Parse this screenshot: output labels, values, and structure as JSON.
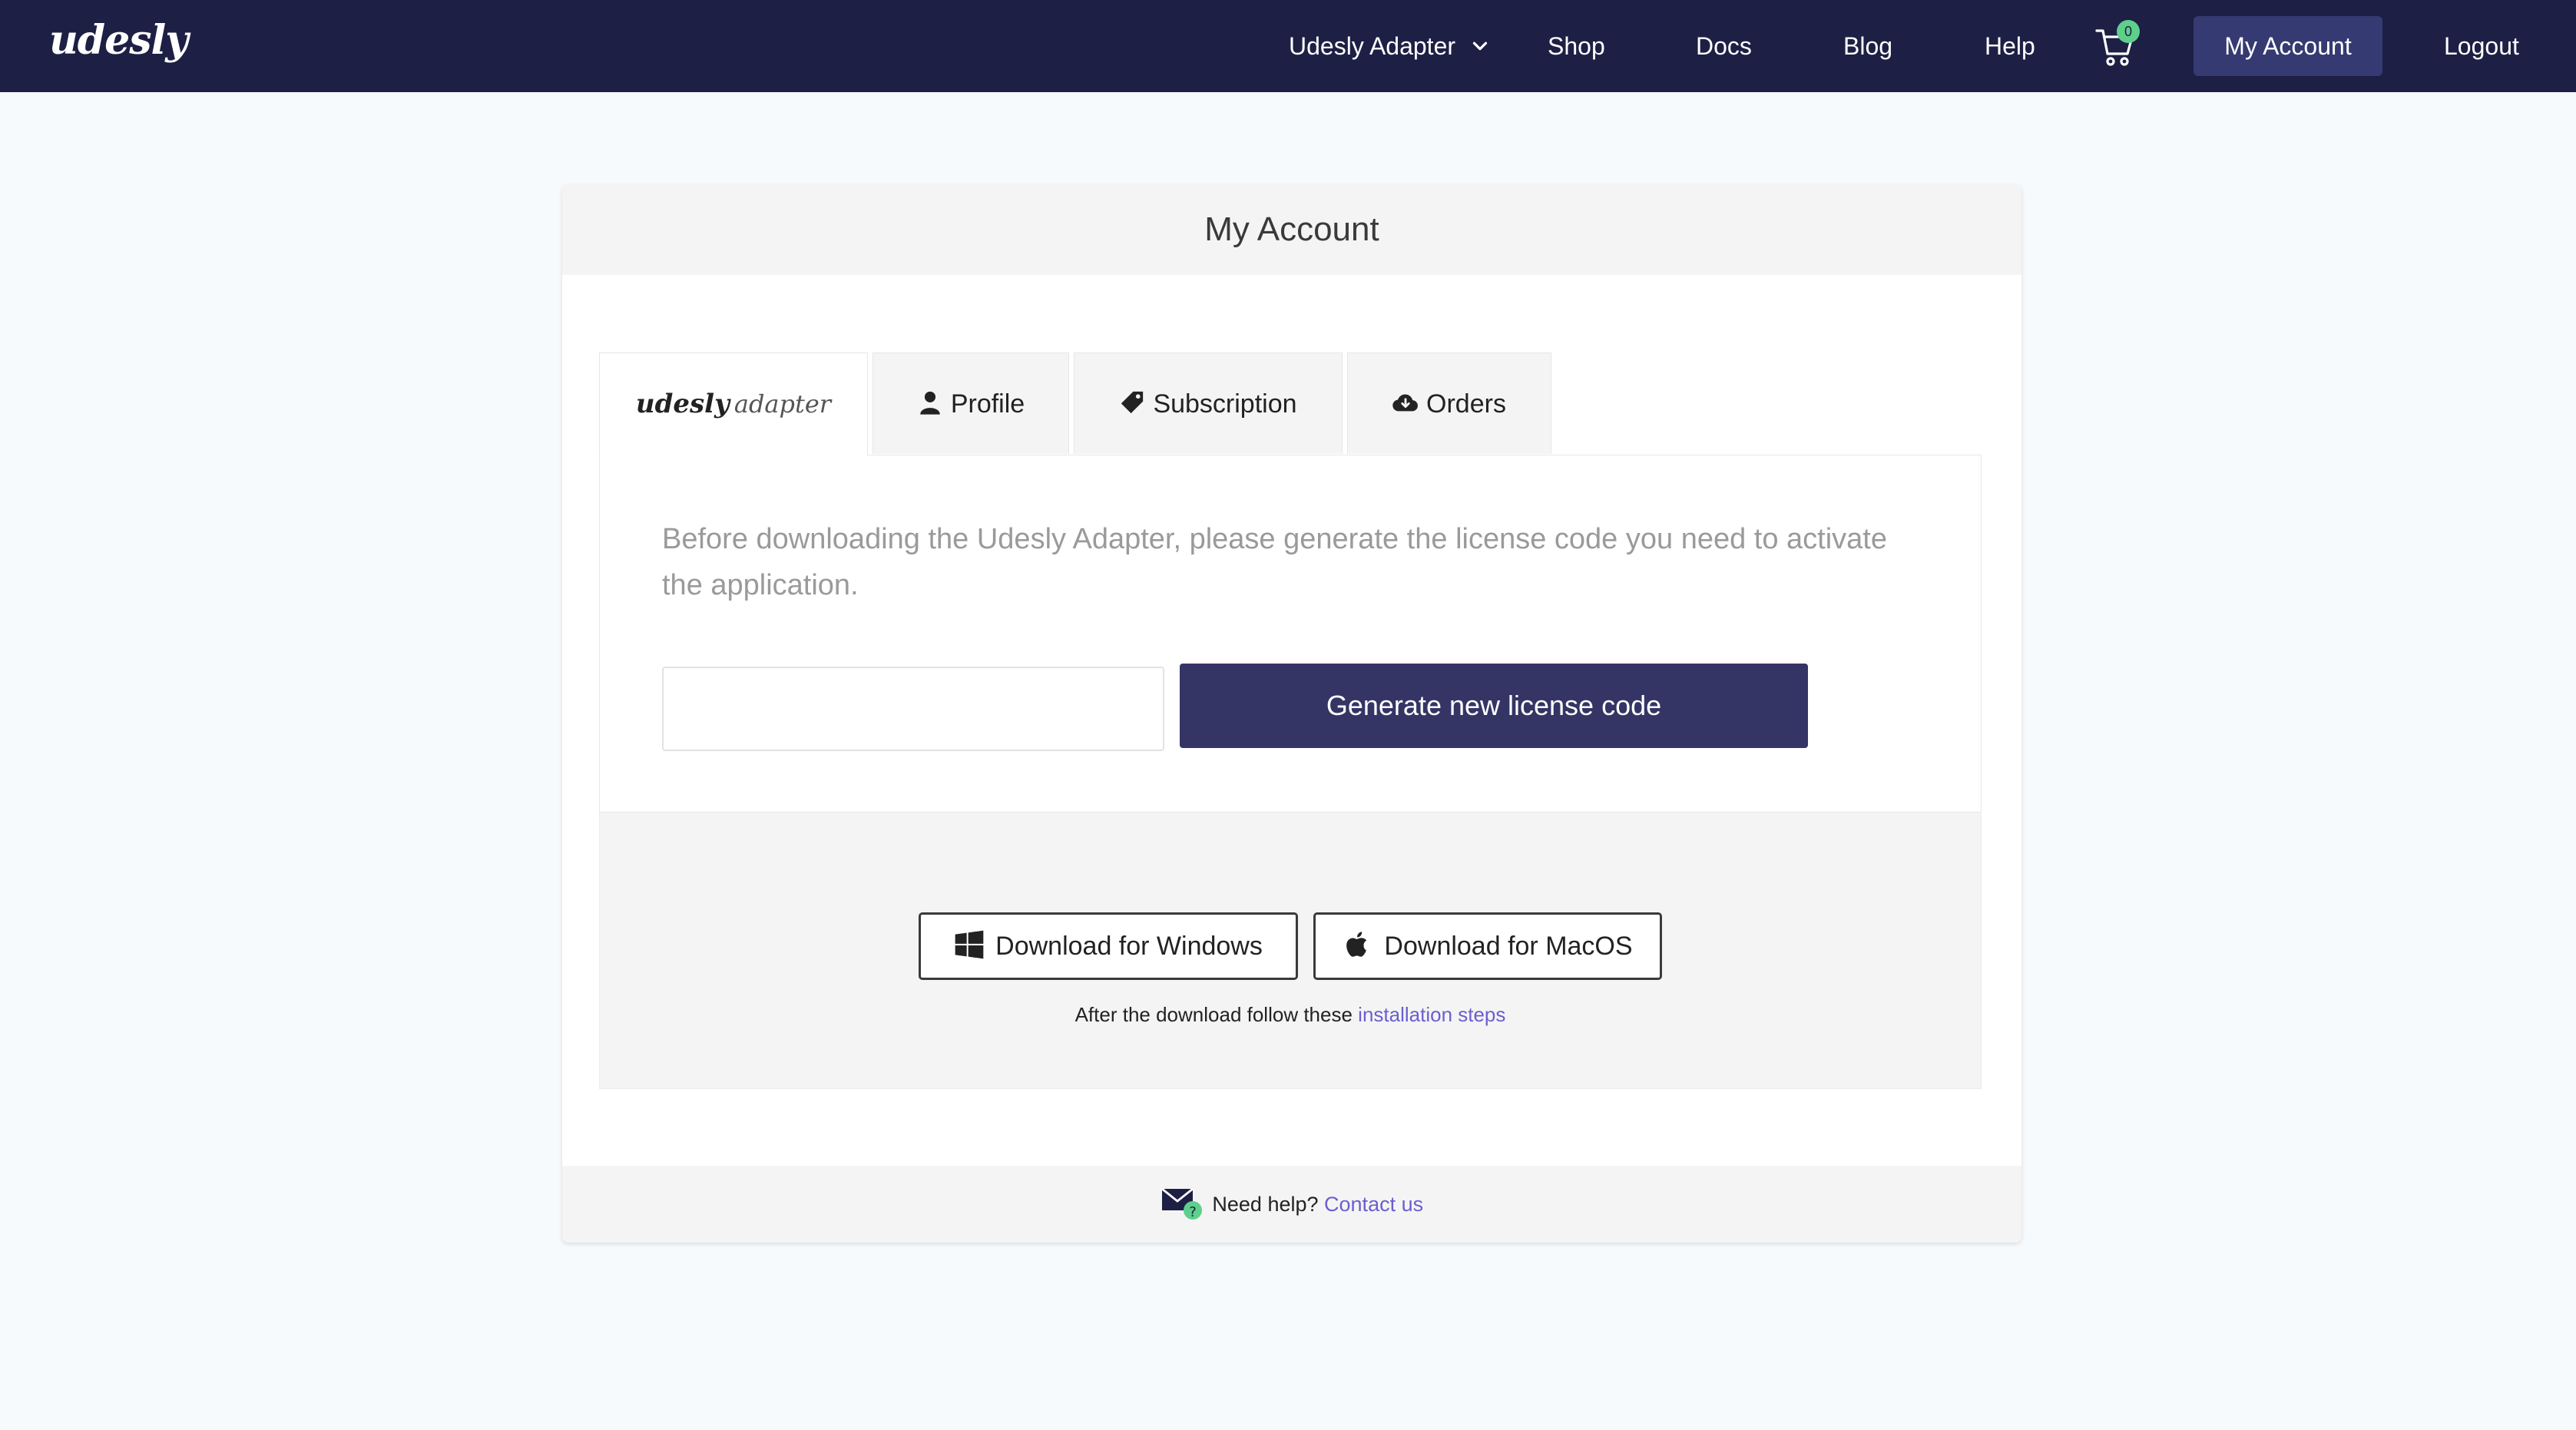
{
  "navbar": {
    "brand": "udesly",
    "items": [
      {
        "label": "Udesly Adapter"
      },
      {
        "label": "Shop"
      },
      {
        "label": "Docs"
      },
      {
        "label": "Blog"
      },
      {
        "label": "Help"
      },
      {
        "label": "My Account"
      },
      {
        "label": "Logout"
      }
    ],
    "cart_count": "0",
    "icons": [
      "chevron-down-icon",
      "cart-icon"
    ]
  },
  "card": {
    "title": "My Account",
    "tabs": [
      {
        "brand": "udesly",
        "label": "adapter"
      },
      {
        "label": "Profile",
        "icon": "user-icon"
      },
      {
        "label": "Subscription",
        "icon": "tag-icon"
      },
      {
        "label": "Orders",
        "icon": "cloud-download-icon"
      }
    ],
    "panel": {
      "text": "Before downloading the Udesly Adapter, please generate the license code you need to activate the application.",
      "license_value": "",
      "generate_label": "Generate new license code"
    },
    "downloads": {
      "windows_label": "Download for Windows",
      "mac_label": "Download for MacOS",
      "note_prefix": "After the download follow these",
      "note_link": "installation steps"
    },
    "footer": {
      "text": "Need help?",
      "link": "Contact us"
    }
  },
  "colors": {
    "navbar_bg": "#1d1f44",
    "active_nav_bg": "#353a72",
    "primary_button": "#343565",
    "badge": "#5fcf8c",
    "link": "#6a5fd0",
    "page_bg": "#f7fafc"
  }
}
